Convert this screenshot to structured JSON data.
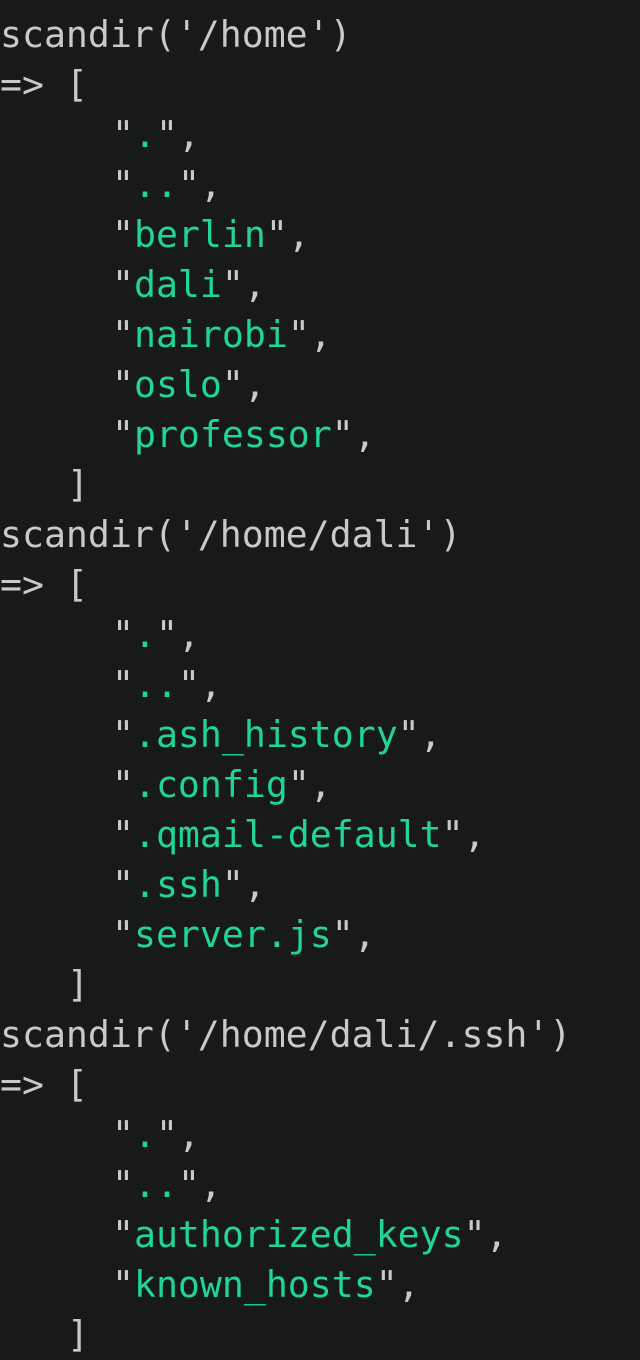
{
  "colors": {
    "background": "#18191b",
    "text": "#c9c9c9",
    "string": "#20d694"
  },
  "blocks": [
    {
      "call": "scandir('/home')",
      "arrow": "=> [",
      "close": "]",
      "items": [
        ".",
        "..",
        "berlin",
        "dali",
        "nairobi",
        "oslo",
        "professor"
      ]
    },
    {
      "call": "scandir('/home/dali')",
      "arrow": "=> [",
      "close": "]",
      "items": [
        ".",
        "..",
        ".ash_history",
        ".config",
        ".qmail-default",
        ".ssh",
        "server.js"
      ]
    },
    {
      "call": "scandir('/home/dali/.ssh')",
      "arrow": "=> [",
      "close": "]",
      "items": [
        ".",
        "..",
        "authorized_keys",
        "known_hosts"
      ]
    }
  ]
}
